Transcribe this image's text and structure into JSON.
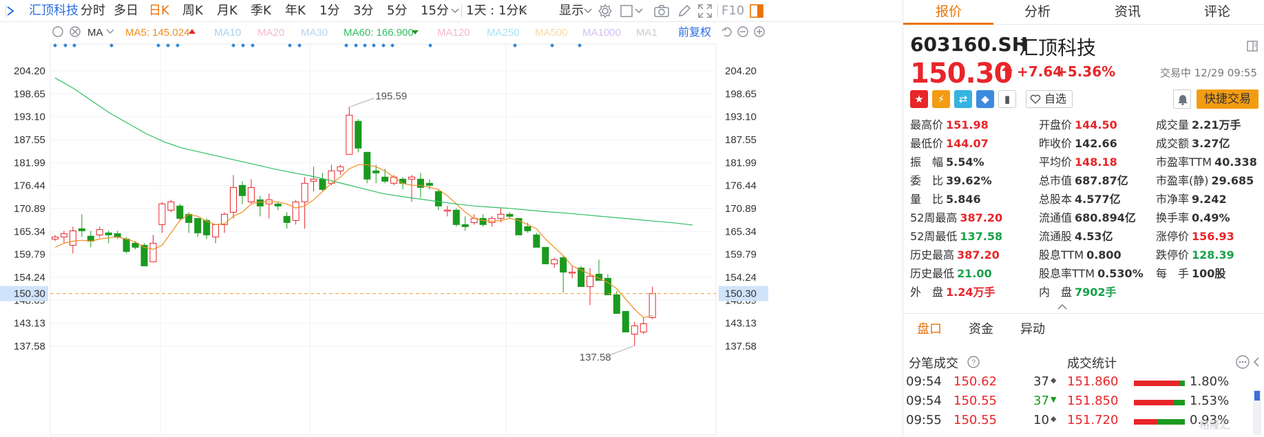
{
  "toolbar": {
    "stock_name": "汇顶科技",
    "periods": [
      "分时",
      "多日",
      "日K",
      "周K",
      "月K",
      "季K",
      "年K",
      "1分",
      "3分",
      "5分",
      "15分"
    ],
    "active_period": "日K",
    "interval_select": "1天 : 1分K",
    "display_label": "显示",
    "f10_label": "F10"
  },
  "ma_bar": {
    "ma_label": "MA",
    "ma5": "MA5: 145.024",
    "ma10": "MA10",
    "ma20": "MA20",
    "ma30": "MA30",
    "ma60": "MA60: 166.900",
    "ma120": "MA120",
    "ma250": "MA250",
    "ma500": "MA500",
    "ma1000": "MA1000",
    "ma_more": "MA1",
    "adjust": "前复权"
  },
  "colors": {
    "up": "#e8252a",
    "down": "#1a9a1f",
    "ma5": "#f08c1e",
    "ma60": "#2fbf62",
    "accent": "#e9730a",
    "link": "#2a6de1"
  },
  "chart_data": {
    "type": "candlestick",
    "y_ticks": [
      "204.20",
      "198.65",
      "193.10",
      "187.55",
      "181.99",
      "176.44",
      "170.89",
      "165.34",
      "159.79",
      "154.24",
      "148.69",
      "143.13",
      "137.58"
    ],
    "ylim": [
      137.58,
      204.2
    ],
    "current_price_label": "150.30",
    "high_annotation": "195.59",
    "low_annotation": "137.58",
    "candles": [
      [
        163.5,
        164.0,
        163.0,
        164.5
      ],
      [
        164.0,
        164.8,
        165.5,
        162.5
      ],
      [
        162.0,
        165.5,
        166.5,
        160.0
      ],
      [
        166.0,
        165.5,
        169.5,
        164.0
      ],
      [
        164.2,
        163.0,
        165.5,
        161.5
      ],
      [
        164.5,
        165.8,
        166.5,
        163.8
      ],
      [
        165.0,
        164.5,
        165.5,
        162.5
      ],
      [
        164.8,
        164.0,
        165.5,
        163.5
      ],
      [
        163.5,
        160.5,
        164.0,
        160.0
      ],
      [
        162.5,
        161.5,
        163.0,
        161.0
      ],
      [
        162.0,
        157.0,
        162.5,
        157.0
      ],
      [
        158.0,
        162.5,
        164.5,
        158.0
      ],
      [
        167.0,
        172.0,
        172.5,
        165.0
      ],
      [
        170.5,
        172.5,
        173.0,
        170.0
      ],
      [
        171.5,
        168.5,
        172.0,
        168.0
      ],
      [
        169.5,
        167.5,
        170.0,
        165.0
      ],
      [
        168.5,
        165.0,
        168.5,
        164.0
      ],
      [
        168.0,
        164.5,
        168.5,
        163.5
      ],
      [
        164.0,
        167.0,
        167.0,
        162.5
      ],
      [
        167.0,
        169.5,
        170.0,
        165.0
      ],
      [
        170.0,
        176.0,
        179.0,
        168.5
      ],
      [
        176.5,
        174.0,
        177.5,
        172.0
      ],
      [
        172.5,
        176.0,
        178.0,
        172.0
      ],
      [
        173.0,
        171.5,
        174.0,
        169.0
      ],
      [
        172.0,
        173.0,
        174.5,
        168.5
      ],
      [
        172.0,
        171.5,
        172.5,
        170.5
      ],
      [
        169.0,
        167.5,
        170.0,
        166.0
      ],
      [
        168.0,
        172.5,
        173.0,
        167.0
      ],
      [
        172.5,
        177.0,
        178.5,
        166.0
      ],
      [
        177.5,
        178.0,
        181.0,
        175.0
      ],
      [
        178.0,
        175.5,
        179.5,
        175.0
      ],
      [
        177.0,
        180.0,
        181.5,
        176.5
      ],
      [
        180.0,
        181.0,
        181.5,
        179.0
      ],
      [
        184.0,
        193.5,
        195.59,
        184.0
      ],
      [
        192.0,
        185.5,
        192.5,
        184.5
      ],
      [
        184.5,
        178.0,
        184.5,
        177.0
      ],
      [
        180.0,
        179.5,
        181.5,
        177.0
      ],
      [
        178.5,
        177.5,
        180.5,
        177.0
      ],
      [
        177.0,
        178.5,
        179.0,
        176.5
      ],
      [
        178.0,
        177.0,
        178.5,
        175.5
      ],
      [
        178.0,
        178.5,
        179.0,
        172.5
      ],
      [
        178.0,
        176.0,
        179.5,
        173.5
      ],
      [
        177.0,
        176.5,
        178.0,
        175.5
      ],
      [
        175.0,
        171.5,
        175.5,
        170.5
      ],
      [
        170.5,
        170.5,
        171.5,
        169.0
      ],
      [
        170.5,
        167.0,
        171.0,
        166.5
      ],
      [
        167.0,
        166.5,
        169.0,
        165.5
      ],
      [
        167.5,
        168.5,
        169.5,
        167.0
      ],
      [
        168.5,
        167.0,
        169.5,
        166.5
      ],
      [
        167.5,
        168.5,
        169.0,
        166.5
      ],
      [
        168.5,
        169.5,
        171.0,
        167.5
      ],
      [
        169.5,
        169.0,
        170.0,
        168.5
      ],
      [
        168.5,
        164.5,
        168.5,
        164.5
      ],
      [
        166.5,
        165.5,
        167.5,
        165.0
      ],
      [
        164.5,
        161.5,
        165.0,
        161.5
      ],
      [
        161.5,
        157.5,
        161.5,
        157.5
      ],
      [
        157.5,
        158.5,
        159.0,
        156.5
      ],
      [
        159.0,
        155.5,
        159.5,
        150.5
      ],
      [
        155.5,
        155.5,
        157.0,
        154.0
      ],
      [
        156.5,
        152.0,
        157.0,
        152.0
      ],
      [
        152.0,
        154.5,
        156.5,
        147.5
      ],
      [
        155.0,
        153.5,
        158.5,
        153.5
      ],
      [
        154.0,
        150.0,
        155.0,
        150.0
      ],
      [
        150.0,
        145.5,
        151.0,
        145.5
      ],
      [
        146.0,
        141.0,
        146.0,
        141.0
      ],
      [
        140.5,
        142.5,
        143.5,
        137.58
      ],
      [
        141.0,
        143.0,
        144.5,
        140.5
      ],
      [
        144.5,
        150.3,
        151.98,
        144.07
      ]
    ],
    "ma5": [
      161.5,
      162.5,
      163.0,
      163.2,
      163.0,
      163.5,
      163.8,
      164.0,
      163.5,
      162.8,
      161.5,
      161.0,
      162.0,
      165.0,
      168.0,
      169.5,
      169.0,
      167.8,
      167.0,
      167.2,
      169.0,
      170.0,
      172.0,
      172.5,
      172.5,
      172.5,
      172.0,
      171.0,
      171.5,
      173.0,
      175.0,
      177.0,
      178.5,
      180.5,
      181.5,
      181.5,
      181.0,
      180.0,
      178.5,
      177.0,
      176.5,
      176.5,
      176.0,
      175.5,
      174.0,
      172.0,
      170.0,
      168.5,
      168.0,
      167.8,
      168.0,
      168.5,
      168.0,
      167.0,
      166.0,
      163.5,
      161.5,
      159.5,
      157.0,
      156.0,
      155.0,
      154.0,
      153.0,
      151.5,
      149.0,
      146.5,
      144.5,
      145.0
    ],
    "ma60": [
      202.5,
      200.0,
      197.0,
      194.0,
      191.5,
      189.0,
      187.0,
      185.5,
      184.5,
      183.5,
      182.5,
      181.5,
      180.5,
      179.6,
      178.8,
      177.8,
      176.7,
      175.6,
      174.5,
      173.8,
      173.2,
      172.6,
      172.0,
      171.5,
      171.2,
      170.9,
      170.5,
      170.1,
      169.8,
      169.4,
      169.0,
      168.6,
      168.2,
      167.8,
      167.4,
      166.9
    ]
  },
  "quote": {
    "tabs": [
      "报价",
      "分析",
      "资讯",
      "评论"
    ],
    "code": "603160.SH",
    "name": "汇顶科技",
    "price": "150.30",
    "change": "+7.64",
    "change_pct": "+5.36%",
    "status": "交易中 12/29 09:55",
    "watch_label": "自选",
    "quick_trade": "快捷交易",
    "fields": [
      {
        "k": "最高价",
        "v": "151.98",
        "c": "red"
      },
      {
        "k": "开盘价",
        "v": "144.50",
        "c": "red"
      },
      {
        "k": "成交量",
        "v": "2.21万手",
        "c": "dark"
      },
      {
        "k": "最低价",
        "v": "144.07",
        "c": "red"
      },
      {
        "k": "昨收价",
        "v": "142.66",
        "c": "dark"
      },
      {
        "k": "成交额",
        "v": "3.27亿",
        "c": "dark"
      },
      {
        "k": "振　幅",
        "v": "5.54%",
        "c": "dark"
      },
      {
        "k": "平均价",
        "v": "148.18",
        "c": "red"
      },
      {
        "k": "市盈率TTM",
        "v": "40.338",
        "c": "dark"
      },
      {
        "k": "委　比",
        "v": "39.62%",
        "c": "dark"
      },
      {
        "k": "总市值",
        "v": "687.87亿",
        "c": "dark"
      },
      {
        "k": "市盈率(静)",
        "v": "29.685",
        "c": "dark"
      },
      {
        "k": "量　比",
        "v": "5.846",
        "c": "dark"
      },
      {
        "k": "总股本",
        "v": "4.577亿",
        "c": "dark"
      },
      {
        "k": "市净率",
        "v": "9.242",
        "c": "dark"
      },
      {
        "k": "52周最高",
        "v": "387.20",
        "c": "red"
      },
      {
        "k": "流通值",
        "v": "680.894亿",
        "c": "dark"
      },
      {
        "k": "换手率",
        "v": "0.49%",
        "c": "dark"
      },
      {
        "k": "52周最低",
        "v": "137.58",
        "c": "green"
      },
      {
        "k": "流通股",
        "v": "4.53亿",
        "c": "dark"
      },
      {
        "k": "涨停价",
        "v": "156.93",
        "c": "red"
      },
      {
        "k": "历史最高",
        "v": "387.20",
        "c": "red"
      },
      {
        "k": "股息TTM",
        "v": "0.800",
        "c": "dark"
      },
      {
        "k": "跌停价",
        "v": "128.39",
        "c": "green"
      },
      {
        "k": "历史最低",
        "v": "21.00",
        "c": "green"
      },
      {
        "k": "股息率TTM",
        "v": "0.530%",
        "c": "dark"
      },
      {
        "k": "每　手",
        "v": "100股",
        "c": "dark"
      },
      {
        "k": "外　盘",
        "v": "1.24万手",
        "c": "red"
      },
      {
        "k": "内　盘",
        "v": "7902手",
        "c": "green"
      }
    ],
    "section_tabs": [
      "盘口",
      "资金",
      "异动"
    ],
    "ticks_title": "分笔成交",
    "stats_title": "成交统计",
    "ticks": [
      {
        "time": "09:54",
        "price": "150.62",
        "vol": "37",
        "dir": "flat"
      },
      {
        "time": "09:54",
        "price": "150.55",
        "vol": "37",
        "dir": "down"
      },
      {
        "time": "09:55",
        "price": "150.55",
        "vol": "10",
        "dir": "flat"
      }
    ],
    "stats": [
      {
        "price": "151.860",
        "pct": "1.80%",
        "share": 1.8
      },
      {
        "price": "151.850",
        "pct": "1.53%",
        "share": 1.53
      },
      {
        "price": "151.720",
        "pct": "0.93%",
        "share": 0.93
      }
    ],
    "watermark": "格隆汇"
  }
}
